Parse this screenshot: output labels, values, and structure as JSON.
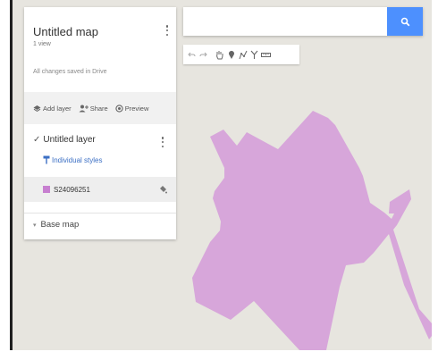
{
  "map": {
    "title": "Untitled map",
    "views": "1 view",
    "saved_status": "All changes saved in Drive",
    "background_color": "#e7e5df",
    "polygon_color": "#d7a6da"
  },
  "actions": {
    "add_layer": "Add layer",
    "share": "Share",
    "preview": "Preview"
  },
  "layer": {
    "checkbox": "✓",
    "name": "Untitled layer",
    "style_label": "Individual styles",
    "feature_name": "S24096251",
    "feature_color": "#c77fd0"
  },
  "basemap": {
    "caret": "▾",
    "label": "Base map"
  },
  "search": {
    "value": "",
    "button_color": "#4d90fe"
  },
  "toolbar": {
    "tools": [
      "undo-icon",
      "redo-icon",
      "hand-icon",
      "marker-icon",
      "draw-line-icon",
      "route-icon",
      "ruler-icon"
    ]
  }
}
